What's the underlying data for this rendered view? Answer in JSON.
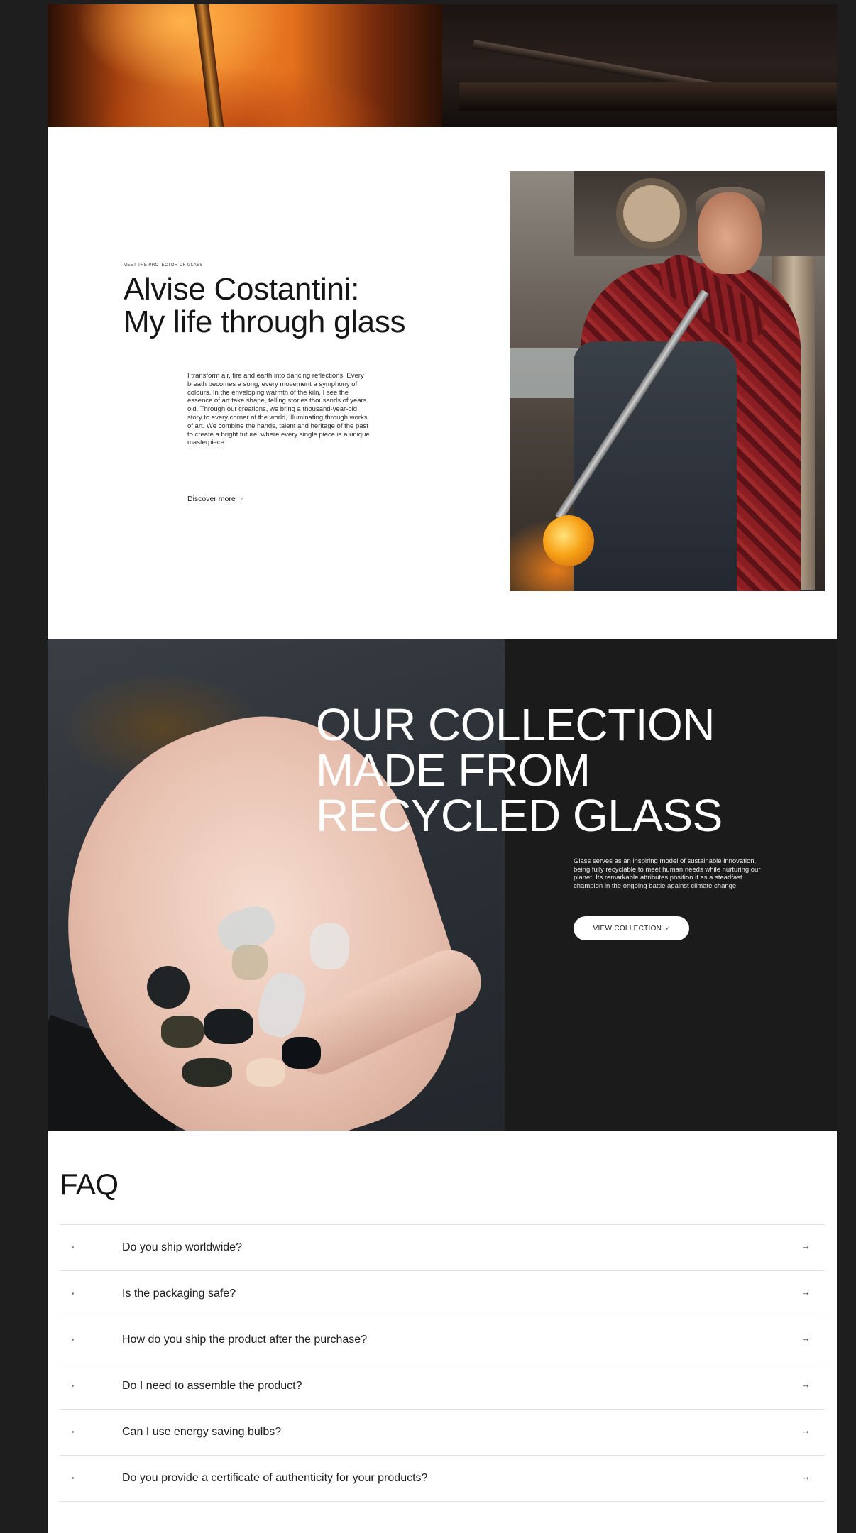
{
  "artisan": {
    "eyebrow": "MEET THE PROTECTOR OF GLASS",
    "title_line1": "Alvise Costantini:",
    "title_line2": "My life through glass",
    "body": "I transform air, fire and earth into dancing reflections. Every breath becomes a song, every movement a symphony of colours. In the enveloping warmth of the kiln, I see the essence of art take shape, telling stories thousands of years old. Through our creations, we bring a thousand-year-old story to every corner of the world, illuminating through works of art. We combine the hands, talent and heritage of the past to create a bright future, where every single piece is a unique masterpiece.",
    "link_label": "Discover more"
  },
  "collection": {
    "title_line1": "OUR COLLECTION",
    "title_line2": "MADE FROM",
    "title_line3": "RECYCLED GLASS",
    "body": "Glass serves as an inspiring model of sustainable innovation, being fully recyclable to meet human needs while nurturing our planet. Its remarkable attributes position it as a steadfast champion in the ongoing battle against climate change.",
    "button_label": "VIEW COLLECTION"
  },
  "faq": {
    "title": "FAQ",
    "items": [
      {
        "question": "Do you ship worldwide?"
      },
      {
        "question": "Is the packaging safe?"
      },
      {
        "question": "How do you ship the product after the purchase?"
      },
      {
        "question": "Do I need to assemble the product?"
      },
      {
        "question": "Can I use energy saving bulbs?"
      },
      {
        "question": "Do you provide a certificate of authenticity for your products?"
      }
    ]
  },
  "icons": {
    "link_arrow": "arrow-down-right-icon",
    "faq_arrow": "arrow-right-icon",
    "faq_marker": "dot-icon"
  },
  "colors": {
    "page_background": "#1e1e1e",
    "dark_panel": "#1b1b1b",
    "text": "#151515",
    "accent_glass": "#f8a318"
  }
}
